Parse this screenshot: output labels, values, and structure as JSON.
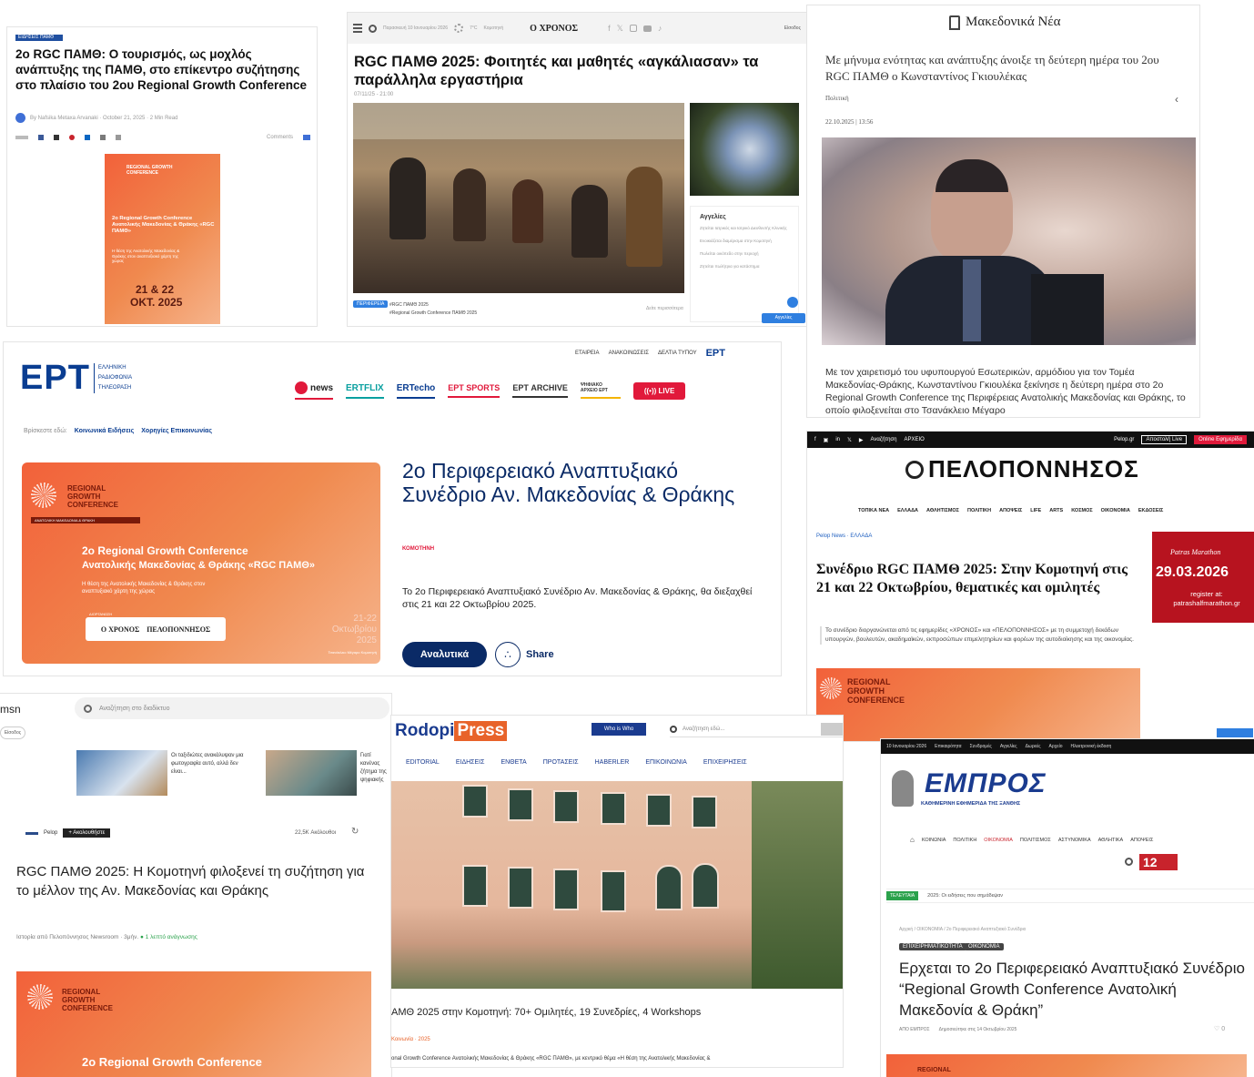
{
  "card1": {
    "tag": "ΕΙΔΗΣΕΙΣ ΠΑΜΘ",
    "title": "2ο RGC ΠΑΜΘ: Ο τουρισμός, ως μοχλός ανάπτυξης της ΠΑΜΘ, στο επίκεντρο συζήτησης στο πλαίσιο του 2ου Regional Growth Conference",
    "byline": "By Nafsika Metaxa Arvanaki · October 21, 2025 · 2 Min Read",
    "comments": "Comments",
    "poster": {
      "heading": "REGIONAL GROWTH CONFERENCE",
      "title": "2ο Regional Growth Conference Ανατολικής Μακεδονίας & Θράκης «RGC ΠΑΜΘ»",
      "body": "Η θέση της Ανατολικής Μακεδονίας & Θράκης στον αναπτυξιακό χάρτη της χώρας",
      "dates": "21 & 22",
      "month": "ΟΚΤ. 2025"
    }
  },
  "card2": {
    "date": "Παρασκευή 10 Ιανουαρίου 2026",
    "temp": "7°C",
    "place": "Κομοτηνή",
    "logo": "Ο ΧΡΟΝΟΣ",
    "login": "Είσοδος",
    "title": "RGC ΠΑΜΘ 2025: Φοιτητές και μαθητές «αγκάλιασαν» τα παράλληλα εργαστήρια",
    "stamp": "07/11/25 - 21:00",
    "cat": "ΠΕΡΙΦΕΡΕΙΑ",
    "tags": "#RGC ΠΑΜΘ 2025",
    "tags2": "#Regional Growth Conference ΠΑΜΘ 2025",
    "side_title": "Αγγελίες",
    "side_items": [
      "Ζητείται Ιατρικός και Ιατρικό Διευθυντής Κλινικής",
      "Ενοικιάζεται διαμέρισμα στην Κομοτηνή",
      "Πωλείται οικόπεδο στην περιοχή",
      "Ζητείται πωλήτρια για κατάστημα"
    ],
    "more": "Δείτε περισσότερα",
    "badge": "Αγγελίες"
  },
  "card3": {
    "logo": "Μακεδονικά Νέα",
    "lede": "Με μήνυμα ενότητας και ανάπτυξης άνοιξε τη δεύτερη ημέρα του 2ου RGC ΠΑΜΘ ο Κωνσταντίνος Γκιουλέκας",
    "cat": "Πολιτική",
    "date": "22.10.2025 | 13:56",
    "body": "Με τον χαιρετισμό του υφυπουργού Εσωτερικών, αρμόδιου για τον Τομέα Μακεδονίας-Θράκης, Κωνσταντίνου Γκιουλέκα ξεκίνησε η δεύτερη ημέρα στο 2ο Regional Growth Conference της Περιφέρειας Ανατολικής Μακεδονίας και Θράκης, το οποίο φιλοξενείται στο Τσανάκλειο Μέγαρο"
  },
  "card4": {
    "logo": "ΕΡΤ",
    "logo_sub": "ΕΛΛΗΝΙΚΗ ΡΑΔΙΟΦΩΝΙΑ ΤΗΛΕΟΡΑΣΗ",
    "top_links": [
      "ΕΤΑΙΡΕΙΑ",
      "ΑΝΑΚΟΙΝΩΣΕΙΣ",
      "ΔΕΛΤΙΑ ΤΥΠΟΥ"
    ],
    "ert_small": "ΕΡΤ",
    "nav": [
      "news",
      "ERTFLIX",
      "ERTecho",
      "ΕΡΤ SPORTS",
      "ΕΡΤ ARCHIVE",
      "ΨΗΦΙΑΚΟ ΑΡΧΕΙΟ ΕΡΤ"
    ],
    "live": "LIVE",
    "tags_label": "Βρίσκεστε εδώ:",
    "tags": [
      "Κοινωνικά Ειδήσεις",
      "Χορηγίες Επικοινωνίας"
    ],
    "banner": {
      "heading": "REGIONAL GROWTH CONFERENCE",
      "ribbon": "ΑΝΑΤΟΛΙΚΗ ΜΑΚΕΔΟΝΙΑ & ΘΡΑΚΗ",
      "title": "2ο Regional Growth Conference",
      "title2": "Ανατολικής Μακεδονίας & Θράκης «RGC ΠΑΜΘ»",
      "body": "Η θέση της Ανατολικής Μακεδονίας & Θράκης στον αναπτυξιακό χάρτη της χώρας",
      "org_label": "ΔΙΟΡΓΑΝΩΣΗ",
      "org1": "Ο ΧΡΟΝΟΣ",
      "org2": "ΠΕΛΟΠΟΝΝΗΣΟΣ",
      "dates": "21-22 Οκτωβρίου 2025",
      "venue": "Τσανάκλειο Μέγαρο Κομοτηνή"
    },
    "headline": "2ο Περιφερειακό Αναπτυξιακό Συνέδριο Αν. Μακεδονίας & Θράκης",
    "location": "ΚΟΜΟΤΗΝΗ",
    "summary": "Το 2ο Περιφερειακό Αναπτυξιακό Συνέδριο Αν. Μακεδονίας & Θράκης, θα διεξαχθεί στις 21 και 22 Οκτωβρίου 2025.",
    "btn": "Αναλυτικά",
    "share": "Share"
  },
  "card5": {
    "top_links": [
      "Αναζήτηση",
      "ΑΡΧΕΙΟ"
    ],
    "top_right": [
      "Pelop.gr",
      "Αποστολή Live",
      "Online Εφημερίδα"
    ],
    "logo": "ΠΕΛΟΠΟΝΝΗΣΟΣ",
    "nav": [
      "ΤΟΠΙΚΑ ΝΕΑ",
      "ΕΛΛΑΔΑ",
      "ΑΘΛΗΤΙΣΜΟΣ",
      "ΠΟΛΙΤΙΚΗ",
      "ΑΠΟΨΕΙΣ",
      "LIFE",
      "ARTS",
      "ΚΟΣΜΟΣ",
      "ΟΙΚΟΝΟΜΙΑ",
      "ΕΚΔΟΣΕΙΣ"
    ],
    "crumb": "Pelop News · ΕΛΛΑΔΑ",
    "title": "Συνέδριο RGC ΠΑΜΘ 2025: Στην Κομοτηνή στις 21 και 22 Οκτωβρίου, θεματικές και ομιλητές",
    "body": "Το συνέδριο διοργανώνεται από τις εφημερίδες «ΧΡΟΝΟΣ» και «ΠΕΛΟΠΟΝΝΗΣΟΣ» με τη συμμετοχή δεκάδων υπουργών, βουλευτών, ακαδημαϊκών, εκπροσώπων επιμελητηρίων και φορέων της αυτοδιοίκησης και της οικονομίας.",
    "ad_brand": "Patras Marathon",
    "ad_date": "29.03.2026",
    "ad_cta": "register at: patrashalfmarathon.gr",
    "banner_heading": "REGIONAL GROWTH CONFERENCE"
  },
  "card6": {
    "logo": "msn",
    "search": "Αναζήτηση στο διαδίκτυο",
    "home": "Είσοδος",
    "thumbs": [
      "Οι ταξιδιώτες ανακάλυψαν μια φωτογραφία αυτό, αλλά δεν είναι...",
      "Γιατί κανένας ζήτημα της ψηφιακής"
    ],
    "source": "Pelop",
    "follow": "+ Ακολουθήστε",
    "likes": "22,5K Ακόλουθοι",
    "title": "RGC ΠΑΜΘ 2025: Η Κομοτηνή φιλοξενεί τη συζήτηση για το μέλλον της Αν. Μακεδονίας και Θράκης",
    "meta": "Ιστορία από Πελοπόννησος Newsroom · 3μήν.",
    "read": "1 λεπτό ανάγνωσης",
    "banner_heading": "REGIONAL GROWTH CONFERENCE",
    "banner_title": "2ο Regional Growth Conference"
  },
  "card7": {
    "logo1": "Rodopi",
    "logo2": "Press",
    "who": "Who is Who",
    "search": "Αναζήτηση εδώ...",
    "nav": [
      "EDITORIAL",
      "ΕΙΔΗΣΕΙΣ",
      "ΕΝΘΕΤΑ",
      "ΠΡΟΤΑΣΕΙΣ",
      "HABERLER",
      "ΕΠΙΚΟΙΝΩΝΙΑ",
      "ΕΠΙΧΕΙΡΗΣΕΙΣ"
    ],
    "caption": "ΑΜΘ 2025 στην Κομοτηνή: 70+ Ομιλητές, 19 Συνεδρίες, 4 Workshops",
    "meta": "Κοινωνία · 2025",
    "body": "onal Growth Conference Ανατολικής Μακεδονίας & Θράκης «RGC ΠΑΜΘ», με κεντρικό θέμα «Η θέση της Ανατολικής Μακεδονίας &"
  },
  "card8": {
    "top": [
      "Επικαιρότητα",
      "Συνδρομές",
      "Αγγελίες",
      "Δωρεές",
      "Αρχείο",
      "Ηλεκτρονική έκδοση"
    ],
    "date": "10 Ιανουαρίου 2026",
    "logo": "ΕΜΠΡΟΣ",
    "logo_sub": "ΚΑΘΗΜΕΡΙΝΗ ΕΦΗΜΕΡΙΔΑ ΤΗΣ ΞΑΝΘΗΣ",
    "nav": [
      "ΚΟΙΝΩΝΙΑ",
      "ΠΟΛΙΤΙΚΗ",
      "ΟΙΚΟΝΟΜΙΑ",
      "ΠΟΛΙΤΙΣΜΟΣ",
      "ΑΣΤΥΝΟΜΙΚΑ",
      "ΑΘΛΗΤΙΚΑ",
      "ΑΠΟΨΕΙΣ"
    ],
    "temp": "12",
    "ticker_label": "ΤΕΛΕΥΤΑΙΑ",
    "ticker": "2025: Οι ειδήσεις που σημάδεψαν",
    "crumb": "Αρχική / ΟΙΚΟΝΟΜΙΑ / 2ο Περιφερειακό Αναπτυξιακό Συνέδριο",
    "chip1": "ΕΠΙΧΕΙΡΗΜΑΤΙΚΟΤΗΤΑ",
    "chip2": "ΟΙΚΟΝΟΜΙΑ",
    "title": "Ερχεται το 2ο Περιφερειακό Αναπτυξιακό Συνέδριο “Regional Growth Conference Ανατολική Μακεδονία & Θράκη”",
    "author": "ΑΠΟ ΕΜΠΡΟΣ",
    "date2": "Δημοσιεύτηκε στις 14 Οκτωβρίου 2025",
    "banner_heading": "REGIONAL"
  },
  "colors": {
    "ert_blue": "#0a3d91",
    "orange": "#f2613a",
    "ert_red": "#e1193b",
    "emprós_blue": "#1a3b8f"
  }
}
